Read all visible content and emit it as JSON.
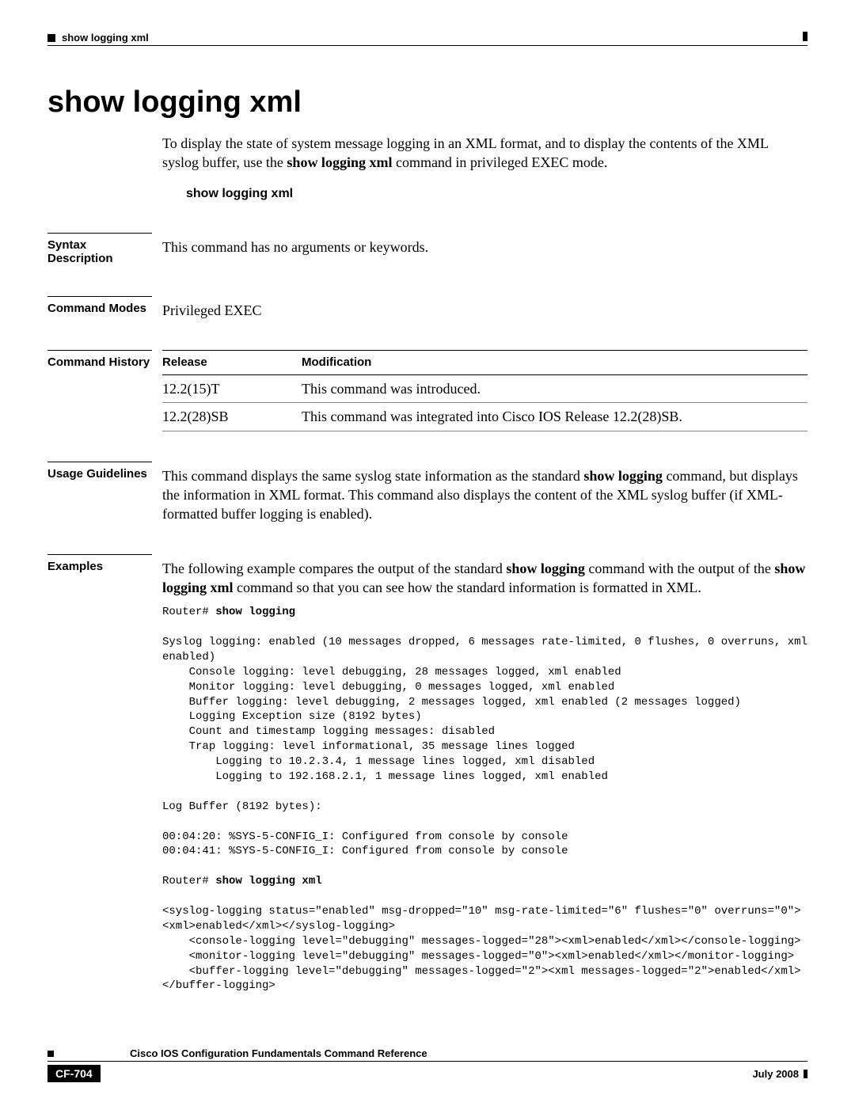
{
  "header": {
    "running": "show logging xml"
  },
  "title": "show logging xml",
  "intro": {
    "pre": "To display the state of system message logging in an XML format, and to display the contents of the XML syslog buffer, use the ",
    "cmd": "show logging xml",
    "post": " command in privileged EXEC mode."
  },
  "syntax_line": "show logging xml",
  "sections": {
    "syntax_desc": {
      "label": "Syntax Description",
      "body": "This command has no arguments or keywords."
    },
    "command_modes": {
      "label": "Command Modes",
      "body": "Privileged EXEC"
    },
    "command_history": {
      "label": "Command History",
      "cols": {
        "release": "Release",
        "modification": "Modification"
      },
      "rows": [
        {
          "release": "12.2(15)T",
          "modification": "This command was introduced."
        },
        {
          "release": "12.2(28)SB",
          "modification": "This command was integrated into Cisco IOS Release 12.2(28)SB."
        }
      ]
    },
    "usage": {
      "label": "Usage Guidelines",
      "body_pre": "This command displays the same syslog state information as the standard ",
      "body_cmd": "show logging",
      "body_post": " command, but displays the information in XML format. This command also displays the content of the XML syslog buffer (if XML-formatted buffer logging is enabled)."
    },
    "examples": {
      "label": "Examples",
      "p_pre": "The following example compares the output of the standard ",
      "p_cmd1": "show logging",
      "p_mid": " command with the output of the ",
      "p_cmd2": "show logging xml",
      "p_post": " command so that you can see how the standard information is formatted in XML.",
      "code1_prompt": "Router# ",
      "code1_cmd": "show logging",
      "code1_body": "\n\nSyslog logging: enabled (10 messages dropped, 6 messages rate-limited, 0 flushes, 0 overruns, xml enabled)\n    Console logging: level debugging, 28 messages logged, xml enabled\n    Monitor logging: level debugging, 0 messages logged, xml enabled\n    Buffer logging: level debugging, 2 messages logged, xml enabled (2 messages logged)\n    Logging Exception size (8192 bytes)\n    Count and timestamp logging messages: disabled\n    Trap logging: level informational, 35 message lines logged\n        Logging to 10.2.3.4, 1 message lines logged, xml disabled\n        Logging to 192.168.2.1, 1 message lines logged, xml enabled\n\nLog Buffer (8192 bytes):\n\n00:04:20: %SYS-5-CONFIG_I: Configured from console by console\n00:04:41: %SYS-5-CONFIG_I: Configured from console by console\n\n",
      "code2_prompt": "Router# ",
      "code2_cmd": "show logging xml",
      "code2_body": "\n\n<syslog-logging status=\"enabled\" msg-dropped=\"10\" msg-rate-limited=\"6\" flushes=\"0\" overruns=\"0\"><xml>enabled</xml></syslog-logging>\n    <console-logging level=\"debugging\" messages-logged=\"28\"><xml>enabled</xml></console-logging>\n    <monitor-logging level=\"debugging\" messages-logged=\"0\"><xml>enabled</xml></monitor-logging>\n    <buffer-logging level=\"debugging\" messages-logged=\"2\"><xml messages-logged=\"2\">enabled</xml></buffer-logging>"
    }
  },
  "footer": {
    "book_title": "Cisco IOS Configuration Fundamentals Command Reference",
    "page_num": "CF-704",
    "date": "July 2008"
  }
}
